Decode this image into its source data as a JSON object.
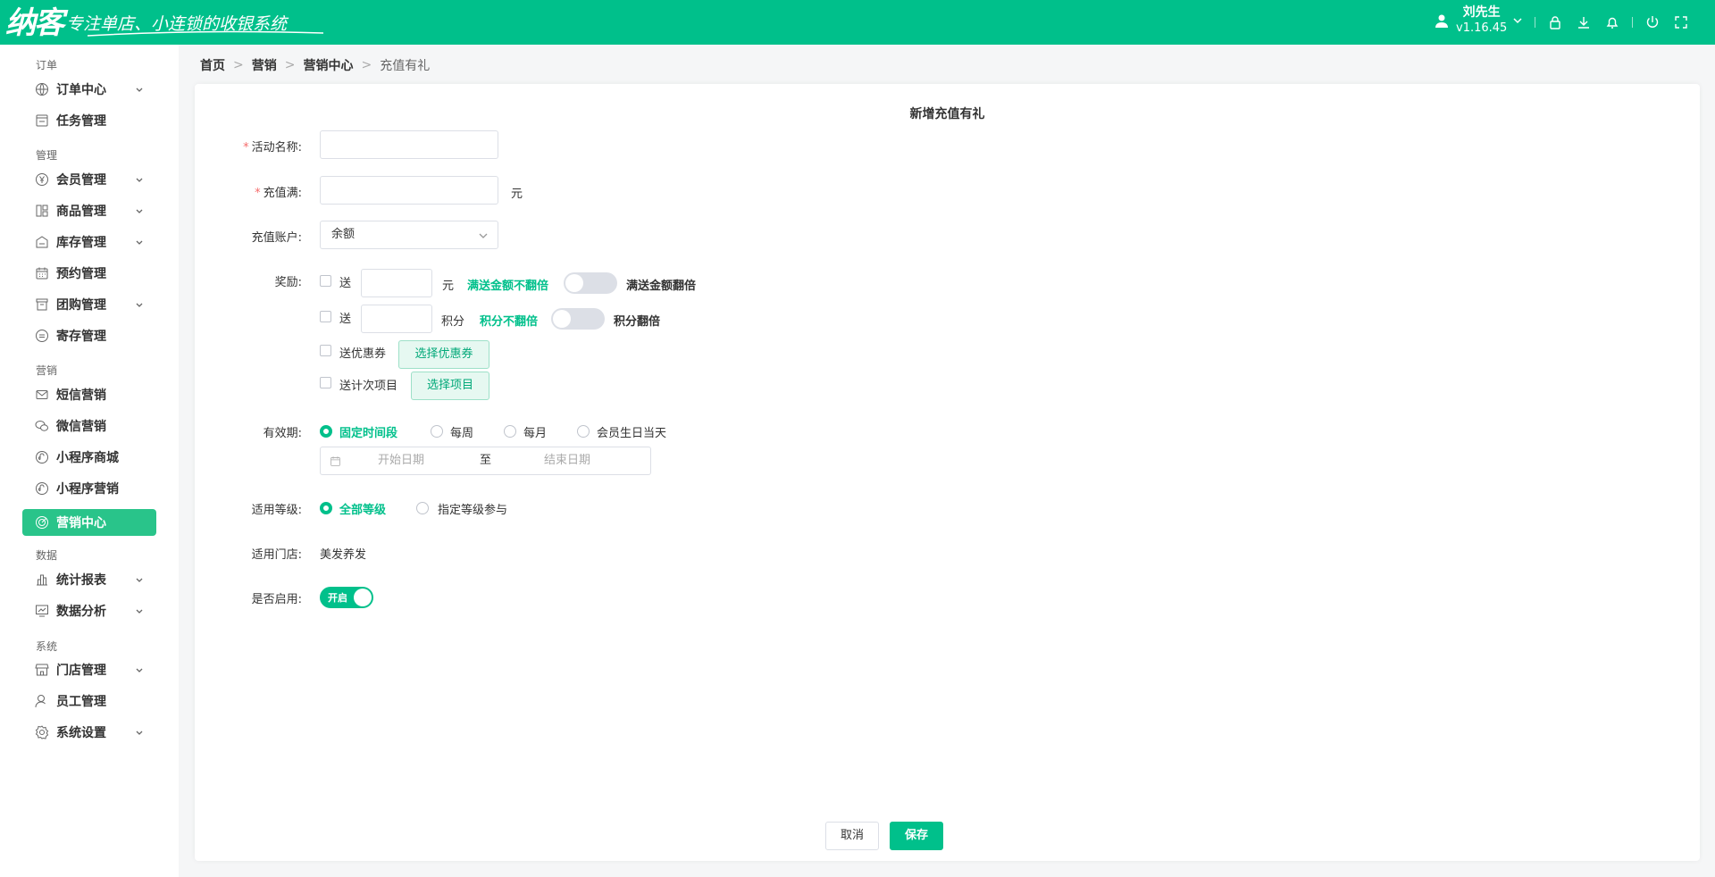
{
  "app": {
    "logo_text": "纳客",
    "slogan": "专注单店、小连锁的收银系统",
    "user_name": "刘先生",
    "version": "v1.16.45",
    "brand_color": "#00c08b"
  },
  "topbar_icons": [
    "user-icon",
    "lock-icon",
    "download-icon",
    "bell-icon",
    "power-icon",
    "fullscreen-icon"
  ],
  "sidebar": {
    "sections": [
      {
        "title": "订单",
        "items": [
          {
            "label": "订单中心",
            "icon": "globe-icon",
            "has_children": true
          },
          {
            "label": "任务管理",
            "icon": "task-icon",
            "has_children": false
          }
        ]
      },
      {
        "title": "管理",
        "items": [
          {
            "label": "会员管理",
            "icon": "yen-icon",
            "has_children": true
          },
          {
            "label": "商品管理",
            "icon": "grid-icon",
            "has_children": true
          },
          {
            "label": "库存管理",
            "icon": "warehouse-icon",
            "has_children": true
          },
          {
            "label": "预约管理",
            "icon": "calendar-icon",
            "has_children": false
          },
          {
            "label": "团购管理",
            "icon": "shop-icon",
            "has_children": true
          },
          {
            "label": "寄存管理",
            "icon": "storage-icon",
            "has_children": false
          }
        ]
      },
      {
        "title": "营销",
        "items": [
          {
            "label": "短信营销",
            "icon": "mail-icon",
            "has_children": false
          },
          {
            "label": "微信营销",
            "icon": "wechat-icon",
            "has_children": false
          },
          {
            "label": "小程序商城",
            "icon": "miniprogram-icon",
            "has_children": false
          },
          {
            "label": "小程序营销",
            "icon": "miniprogram-icon",
            "has_children": false
          },
          {
            "label": "营销中心",
            "icon": "target-icon",
            "has_children": false,
            "active": true
          }
        ]
      },
      {
        "title": "数据",
        "items": [
          {
            "label": "统计报表",
            "icon": "bar-chart-icon",
            "has_children": true
          },
          {
            "label": "数据分析",
            "icon": "monitor-chart-icon",
            "has_children": true
          }
        ]
      },
      {
        "title": "系统",
        "items": [
          {
            "label": "门店管理",
            "icon": "store-icon",
            "has_children": true
          },
          {
            "label": "员工管理",
            "icon": "person-icon",
            "has_children": false
          },
          {
            "label": "系统设置",
            "icon": "gear-icon",
            "has_children": true
          }
        ]
      }
    ]
  },
  "breadcrumb": {
    "home": "首页",
    "level1": "营销",
    "level2": "营销中心",
    "current": "充值有礼",
    "sep": ">"
  },
  "form": {
    "title": "新增充值有礼",
    "required_mark": "*",
    "name": {
      "label": "活动名称:",
      "value": ""
    },
    "recharge": {
      "label": "充值满:",
      "value": "",
      "unit": "元"
    },
    "account": {
      "label": "充值账户:",
      "value": "余额"
    },
    "reward": {
      "label": "奖励:",
      "amount": {
        "send": "送",
        "value": "",
        "unit": "元",
        "off_label": "满送金额不翻倍",
        "on_label": "满送金额翻倍",
        "checked": false,
        "double": false
      },
      "points": {
        "send": "送",
        "value": "",
        "unit": "积分",
        "off_label": "积分不翻倍",
        "on_label": "积分翻倍",
        "checked": false,
        "double": false
      },
      "coupon": {
        "label": "送优惠券",
        "button": "选择优惠券",
        "checked": false
      },
      "project": {
        "label": "送计次项目",
        "button": "选择项目",
        "checked": false
      }
    },
    "validity": {
      "label": "有效期:",
      "options": [
        "固定时间段",
        "每周",
        "每月",
        "会员生日当天"
      ],
      "selected": 0,
      "start_placeholder": "开始日期",
      "to": "至",
      "end_placeholder": "结束日期"
    },
    "level": {
      "label": "适用等级:",
      "options": [
        "全部等级",
        "指定等级参与"
      ],
      "selected": 0
    },
    "store": {
      "label": "适用门店:",
      "value": "美发养发"
    },
    "enabled": {
      "label": "是否启用:",
      "switch_text": "开启",
      "on": true
    }
  },
  "actions": {
    "cancel": "取消",
    "save": "保存"
  }
}
